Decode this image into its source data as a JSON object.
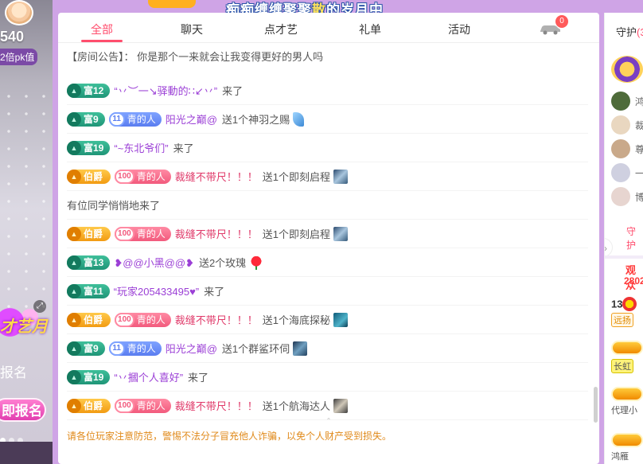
{
  "left": {
    "pk_count": "540",
    "pk_tag": "2倍pk值",
    "talent_text": "才艺月",
    "signup_label": "报名",
    "signup_button": "即报名",
    "expand_icon": "expand-icon"
  },
  "banner": {
    "song_title_part1": "痴痴缠缠聚聚",
    "song_title_highlight": "散",
    "song_title_part2": "的岁月中"
  },
  "tabs": [
    {
      "label": "全部",
      "active": true
    },
    {
      "label": "聊天",
      "active": false
    },
    {
      "label": "点才艺",
      "active": false
    },
    {
      "label": "礼单",
      "active": false
    },
    {
      "label": "活动",
      "active": false
    }
  ],
  "car_badge": "0",
  "announcement": "【房间公告】：  你是那个一来就会让我变得更好的男人吗",
  "messages": [
    {
      "kind": "enter",
      "level_type": "rich",
      "level": "富12",
      "name": "“丷︶一↘驿動的∷↙丷”",
      "text": "来了"
    },
    {
      "kind": "gift",
      "level_type": "rich",
      "level": "富9",
      "fan_color": "blue",
      "fan_num": "11",
      "fan_name": "青的人",
      "name": "阳光之巅@",
      "text": "送1个神羽之赐",
      "gift": "feather"
    },
    {
      "kind": "enter",
      "level_type": "rich",
      "level": "富19",
      "name": "“~东北爷们”",
      "text": "来了"
    },
    {
      "kind": "gift",
      "level_type": "noble",
      "level": "伯爵",
      "fan_color": "pink",
      "fan_num": "100",
      "fan_name": "青的人",
      "name": "裁缝不带尺！！！",
      "text": "送1个即刻启程",
      "gift": "scene"
    },
    {
      "kind": "system",
      "text": "有位同学悄悄地来了"
    },
    {
      "kind": "gift",
      "level_type": "noble",
      "level": "伯爵",
      "fan_color": "pink",
      "fan_num": "100",
      "fan_name": "青的人",
      "name": "裁缝不带尺！！！",
      "text": "送1个即刻启程",
      "gift": "scene"
    },
    {
      "kind": "gift2",
      "level_type": "rich",
      "level": "富13",
      "name": "❥@@小黑@@❥",
      "text": "送2个玫瑰",
      "gift": "rose"
    },
    {
      "kind": "enter",
      "level_type": "rich",
      "level": "富11",
      "name": "“玩家205433495♥”",
      "text": "来了"
    },
    {
      "kind": "gift",
      "level_type": "noble",
      "level": "伯爵",
      "fan_color": "pink",
      "fan_num": "100",
      "fan_name": "青的人",
      "name": "裁缝不带尺！！！",
      "text": "送1个海底探秘",
      "gift": "sea"
    },
    {
      "kind": "gift",
      "level_type": "rich",
      "level": "富9",
      "fan_color": "blue",
      "fan_num": "11",
      "fan_name": "青的人",
      "name": "阳光之巅@",
      "text": "送1个群鲨环伺",
      "gift": "storm"
    },
    {
      "kind": "enter",
      "level_type": "rich",
      "level": "富19",
      "name": "“丷摑个人喜好”",
      "text": "来了"
    },
    {
      "kind": "gift",
      "level_type": "noble",
      "level": "伯爵",
      "fan_color": "pink",
      "fan_num": "100",
      "fan_name": "青的人",
      "name": "裁缝不带尺！！！",
      "text": "送1个航海达人",
      "gift": "master"
    }
  ],
  "warning": "请各位玩家注意防范，警惕不法分子冒充他人诈骗，以免个人财产受到损失。",
  "right": {
    "guard_title": "守护",
    "guard_count": "(3",
    "guards": [
      {
        "name": "鸿",
        "color": "#4e6b3a"
      },
      {
        "name": "裁",
        "color": "#e9d7c0"
      },
      {
        "name": "尊",
        "color": "#c9a98a"
      },
      {
        "name": "一",
        "color": "#cfd0e0"
      },
      {
        "name": "博",
        "color": "#e7d5d0"
      }
    ],
    "guard_link": "守护",
    "viewers_label": "观众",
    "viewers_count": "2802",
    "rank_top_value": "13",
    "rank_top_tag": "远扬",
    "rank_second_tag": "长虹",
    "rank_third_name": "代理小",
    "rank_fourth_name": "鸿雁"
  }
}
